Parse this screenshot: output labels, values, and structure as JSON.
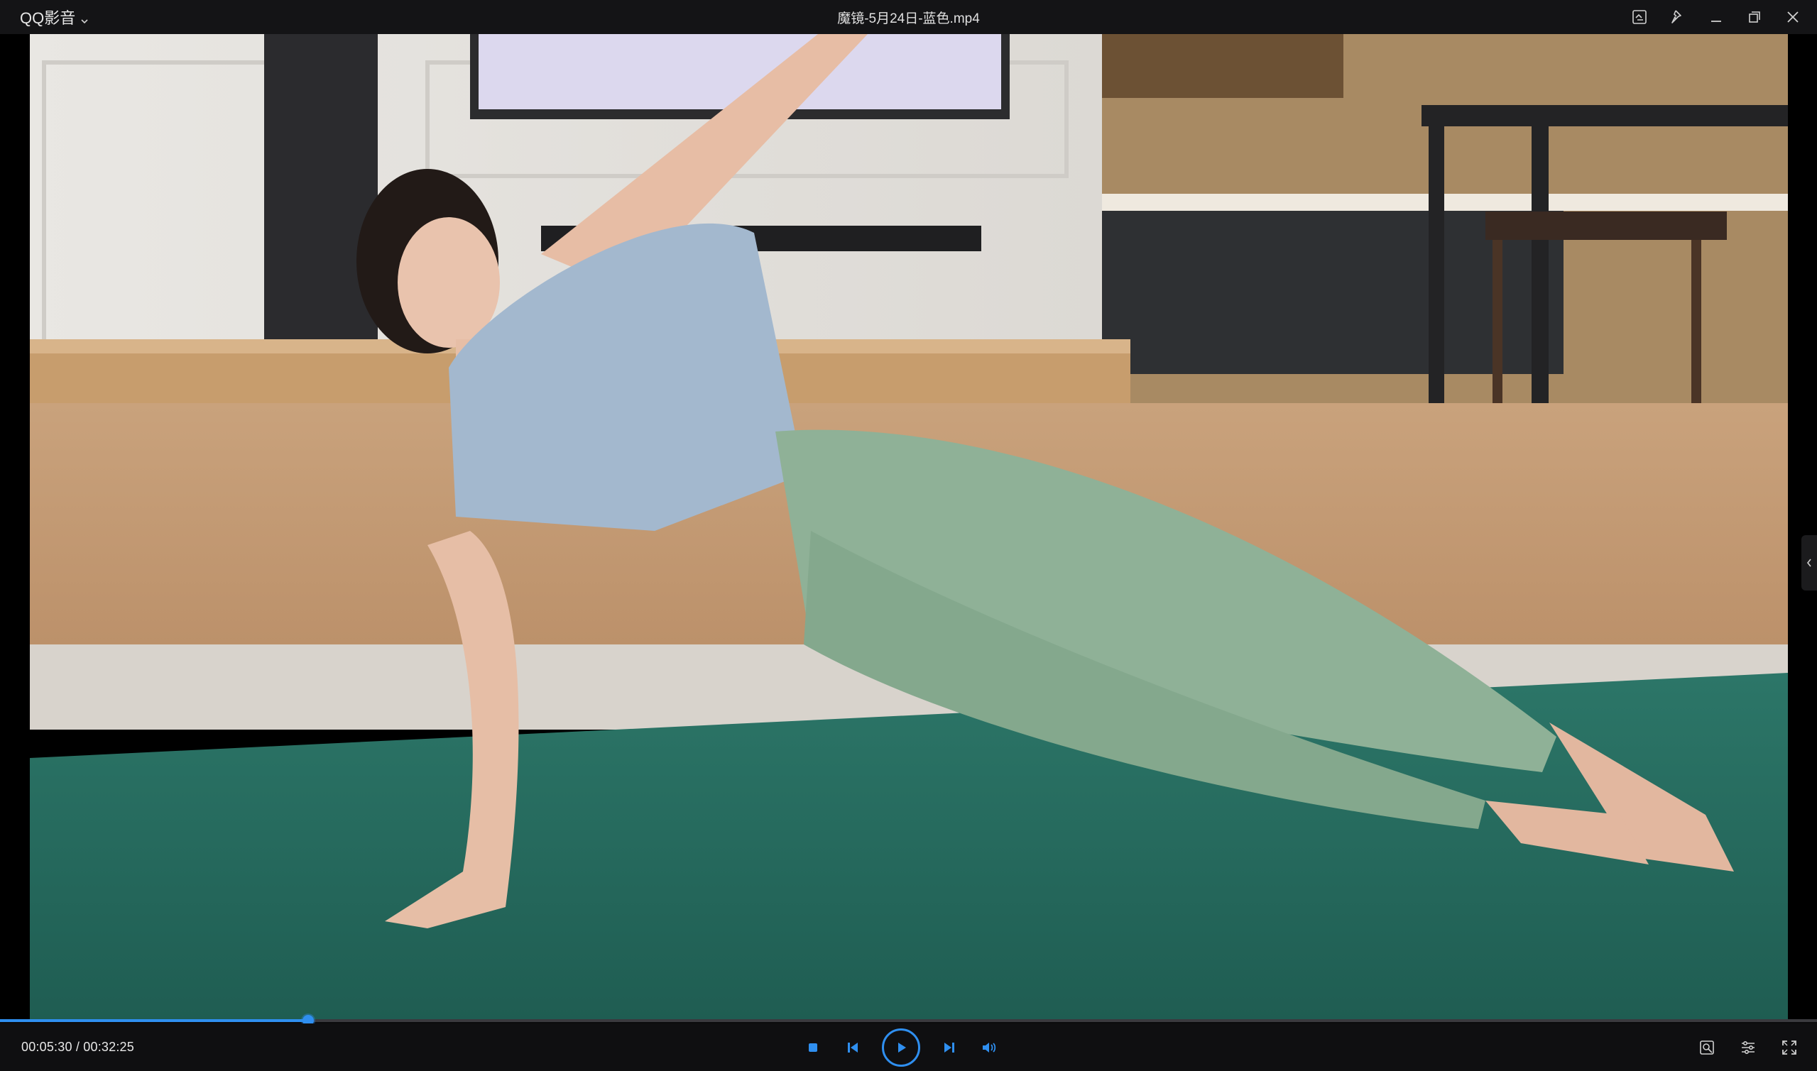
{
  "app": {
    "menu_label": "QQ影音",
    "window_title": "魔镜-5月24日-蓝色.mp4"
  },
  "icons": {
    "app_menu_chevron": "chevron-down-icon",
    "screenshot": "screen-capture-icon",
    "pin": "pin-icon",
    "minimize": "minimize-icon",
    "restore": "restore-icon",
    "close": "close-icon",
    "side_panel": "chevron-left-icon",
    "stop": "stop-icon",
    "previous": "previous-icon",
    "play": "play-icon",
    "next": "next-icon",
    "volume": "volume-icon",
    "capture": "capture-icon",
    "settings": "settings-icon",
    "fullscreen": "fullscreen-icon"
  },
  "playback": {
    "current_time": "00:05:30",
    "separator": " / ",
    "total_time": "00:32:25",
    "progress_fraction": 0.1697
  },
  "colors": {
    "accent": "#2f8ff0",
    "titlebar_bg": "#141416",
    "controls_bg": "#0f0f11"
  }
}
